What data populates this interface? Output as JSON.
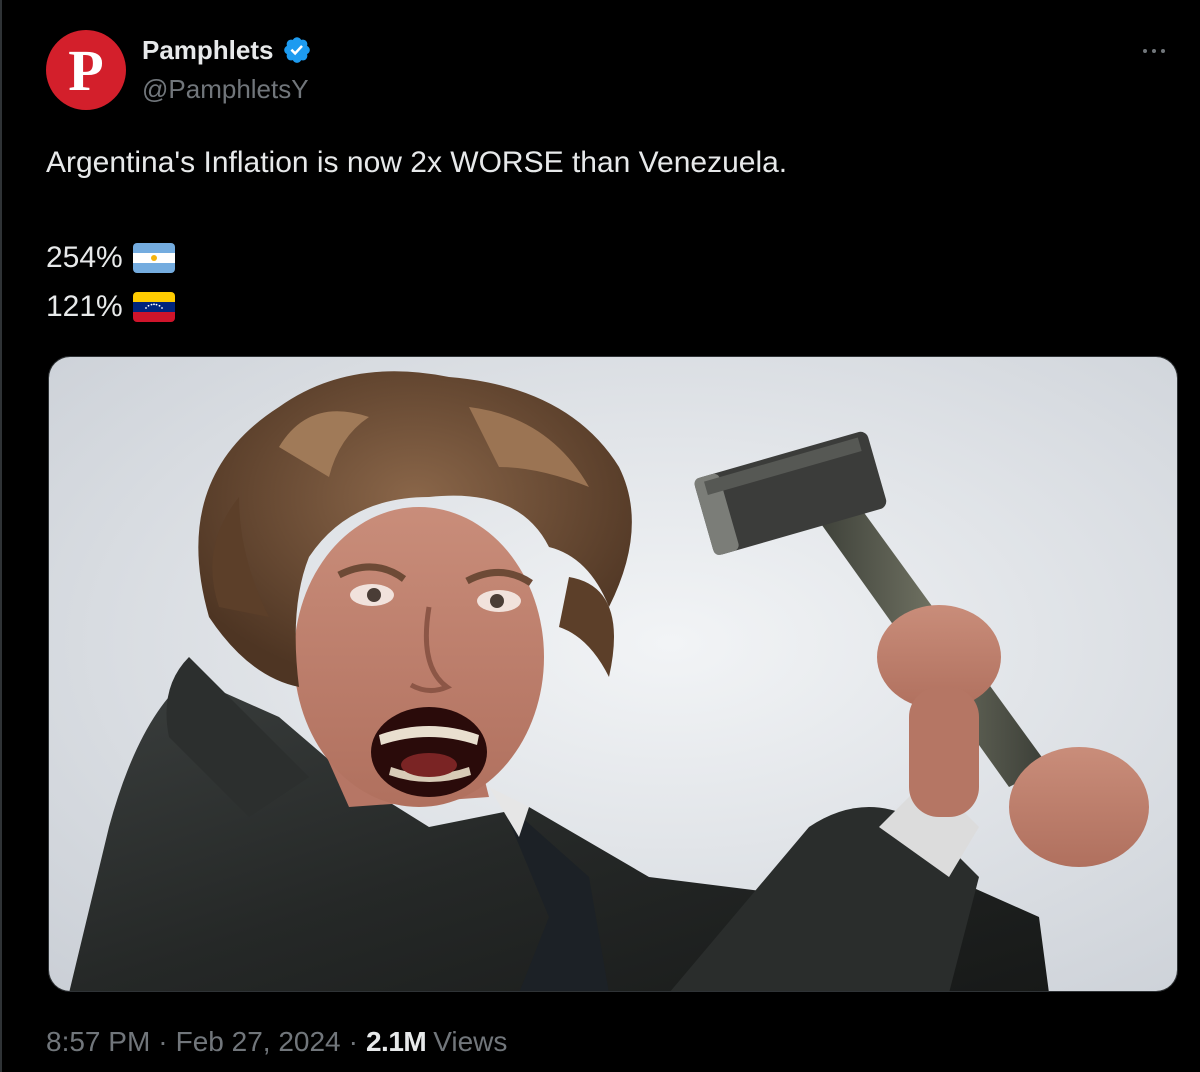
{
  "author": {
    "display_name": "Pamphlets",
    "handle": "@PamphletsY",
    "avatar_letter": "P",
    "avatar_color": "#d31f2b",
    "verified": true,
    "verified_icon": "verified-badge-icon",
    "verified_color": "#1d9bf0"
  },
  "menu": {
    "more_icon": "more-horizontal-icon"
  },
  "tweet": {
    "headline": "Argentina's Inflation is now 2x WORSE than Venezuela.",
    "stats": [
      {
        "value": "254%",
        "flag": "argentina-flag-icon"
      },
      {
        "value": "121%",
        "flag": "venezuela-flag-icon"
      }
    ]
  },
  "media": {
    "type": "photo"
  },
  "footer": {
    "time": "8:57 PM",
    "separator": "·",
    "date": "Feb 27, 2024",
    "views_count": "2.1M",
    "views_label": "Views"
  },
  "colors": {
    "background": "#000000",
    "primary_text": "#e7e9ea",
    "secondary_text": "#71767b",
    "accent": "#1d9bf0"
  }
}
